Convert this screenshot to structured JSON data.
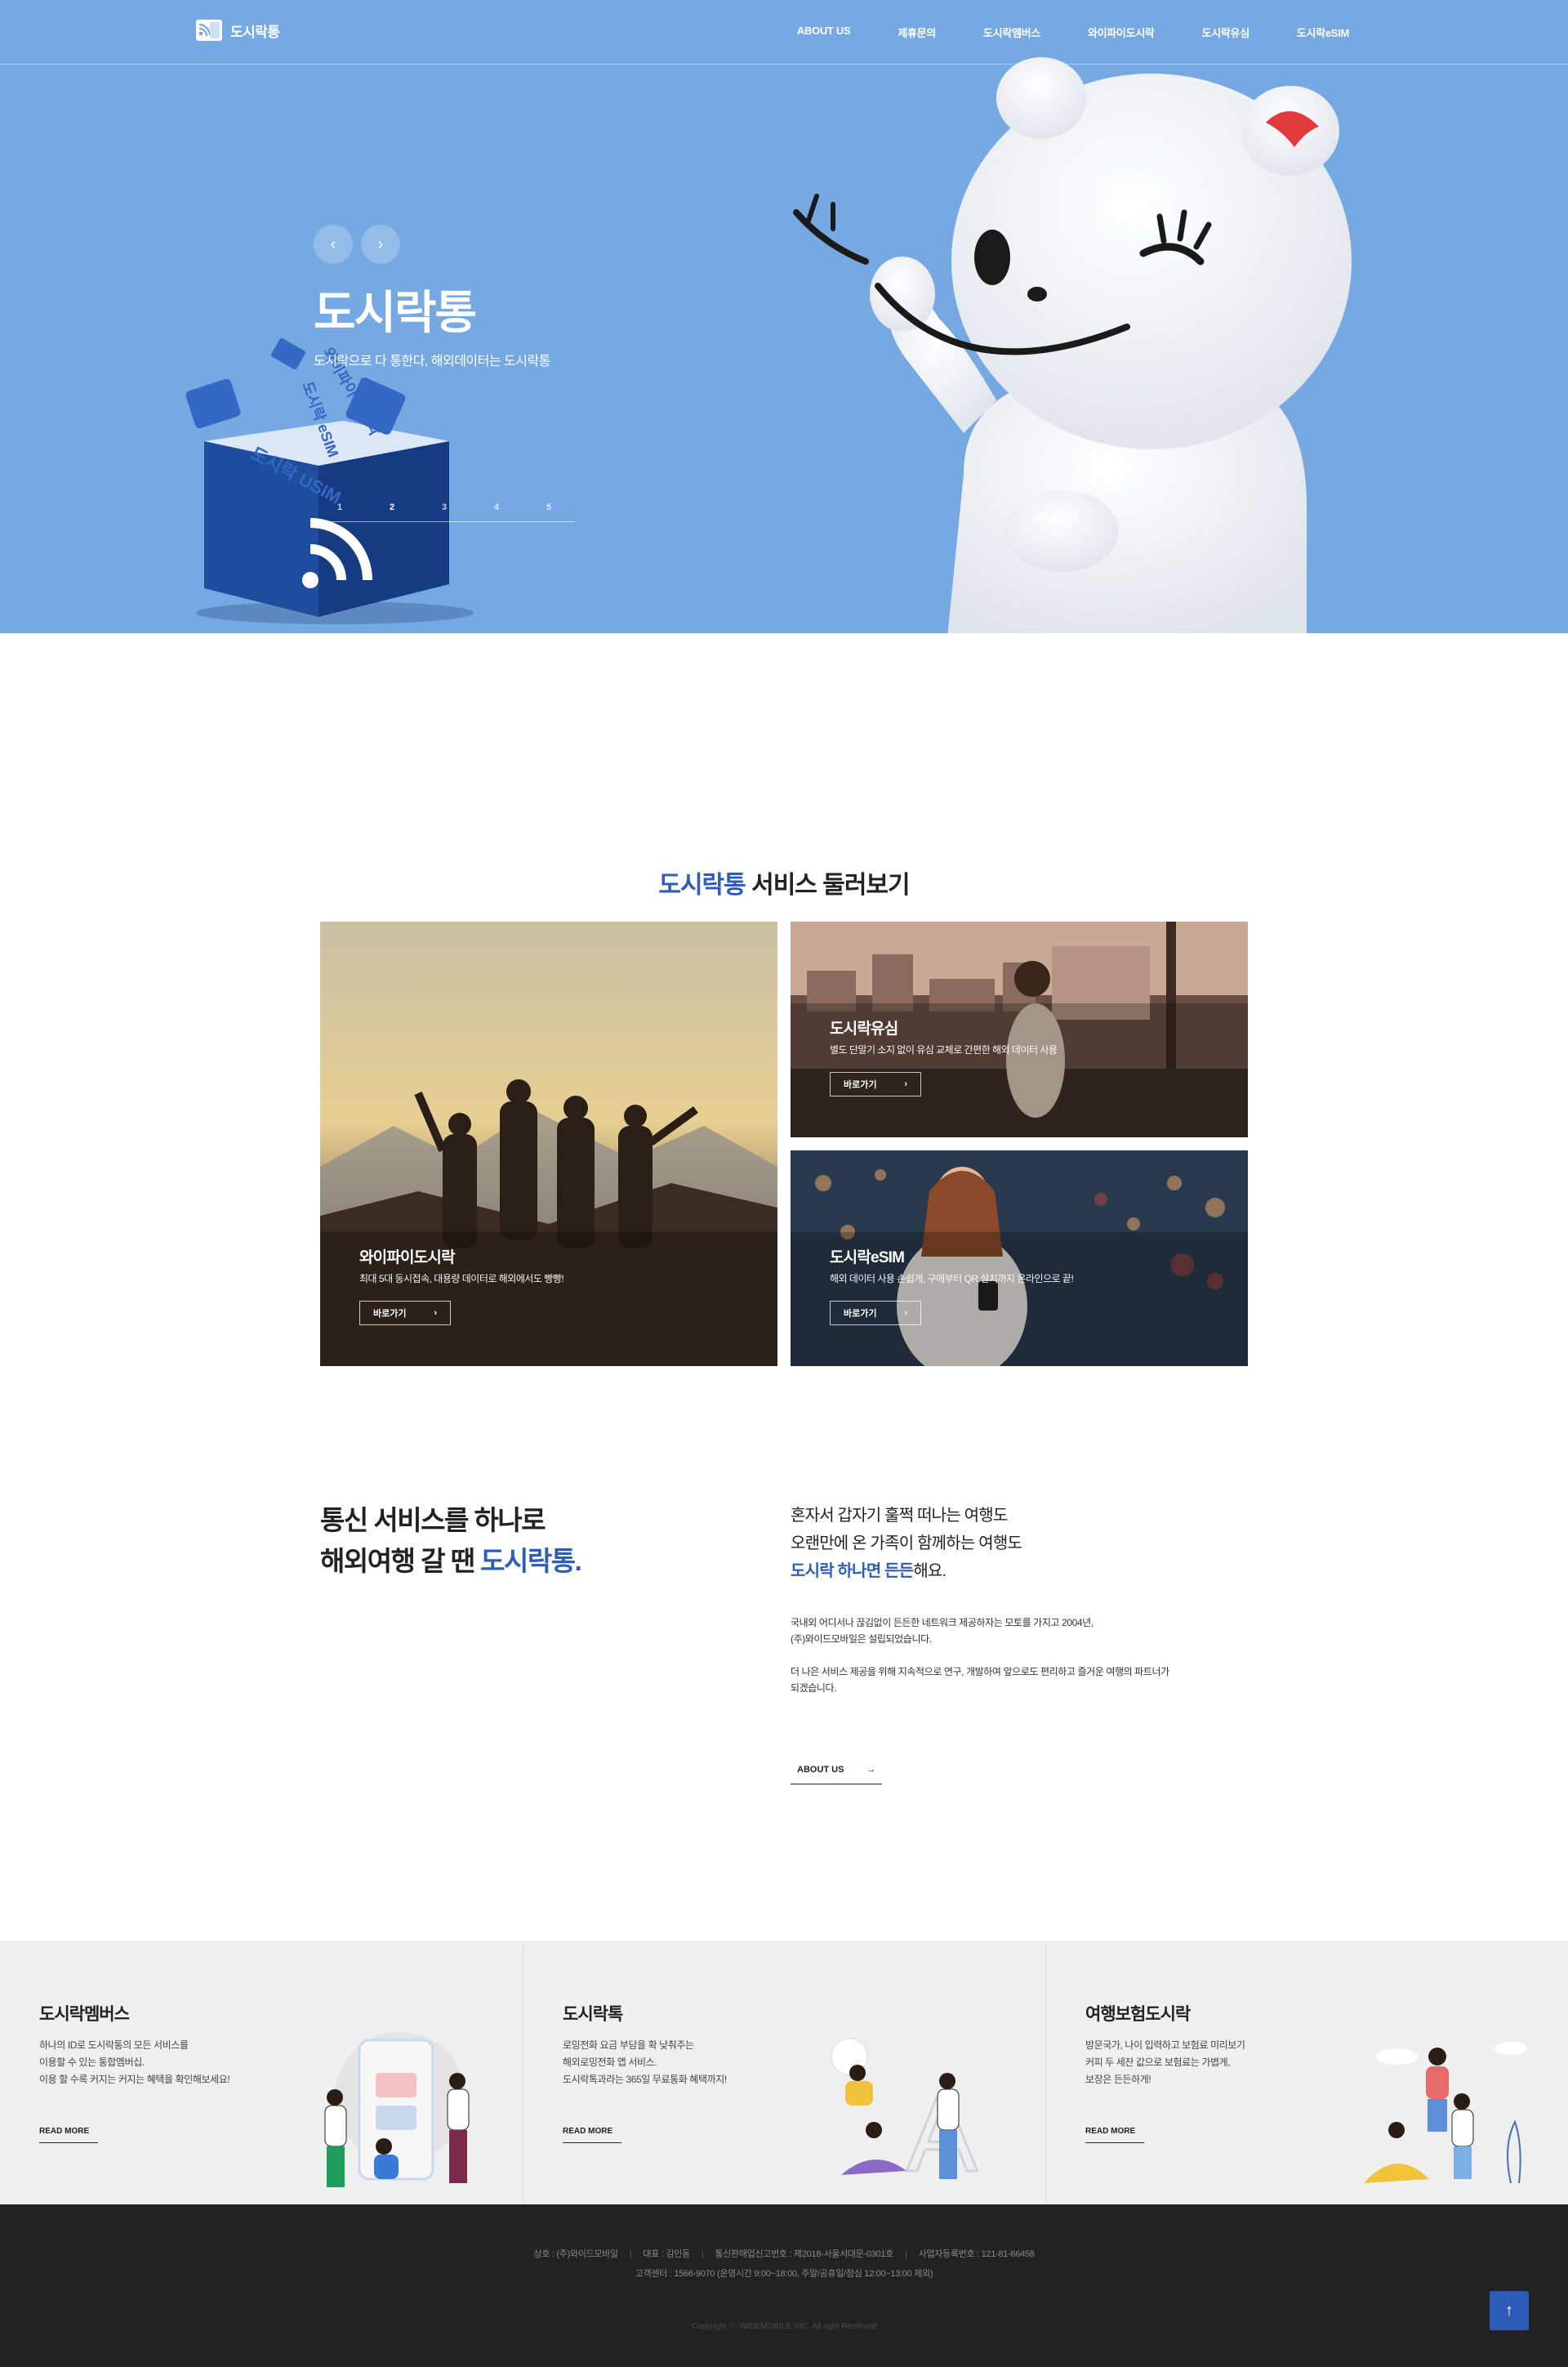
{
  "header": {
    "logo_text": "도시락통",
    "menu": [
      "ABOUT US",
      "제휴문의",
      "도시락멤버스",
      "와이파이도시락",
      "도시락유심",
      "도시락eSIM"
    ]
  },
  "hero": {
    "title": "도시락통",
    "subtitle": "도시락으로 다 통한다, 해외데이터는 도시락통",
    "pager": [
      "1",
      "2",
      "3",
      "4",
      "5"
    ],
    "active_page": "2",
    "prev_icon": "chevron-left-icon",
    "next_icon": "chevron-right-icon",
    "cube_labels": [
      "도시락 USIM",
      "도시락 eSIM",
      "와이파이 도시락"
    ]
  },
  "services": {
    "heading_accent": "도시락통",
    "heading_rest": " 서비스 둘러보기",
    "cards": [
      {
        "title": "와이파이도시락",
        "desc": "최대 5대 동시접속, 대용량 데이터로 해외에서도 빵빵!",
        "button": "바로가기"
      },
      {
        "title": "도시락유심",
        "desc": "별도 단말기 소지 없이 유심 교체로 간편한 해외 데이터 사용",
        "button": "바로가기"
      },
      {
        "title": "도시락eSIM",
        "desc": "해외 데이터 사용 손쉽게, 구매부터 QR 설치까지 온라인으로 끝!",
        "button": "바로가기"
      }
    ]
  },
  "about": {
    "headline_line1": "통신 서비스를 하나로",
    "headline_line2_pre": "해외여행 갈 땐 ",
    "headline_line2_accent": "도시락통.",
    "lead_line1": "혼자서 갑자기 훌쩍 떠나는 여행도",
    "lead_line2": "오랜만에 온 가족이 함께하는 여행도",
    "lead_line3_accent": "도시락 하나면 든든",
    "lead_line3_rest": "해요.",
    "body1_line1": "국내외 어디서나 끊김없이 든든한 네트워크 제공하자는 모토를 가지고 2004년,",
    "body1_line2": "(주)와이드모바일은 설립되었습니다.",
    "body2_line1": "더 나은 서비스 제공을 위해 지속적으로 연구, 개발하여 앞으로도 편리하고 즐거운 여행의 파트너가",
    "body2_line2": "되겠습니다.",
    "button": "ABOUT US",
    "button_icon": "arrow-right-icon"
  },
  "promo": [
    {
      "title": "도시락멤버스",
      "lines": [
        "하나의 ID로 도시락통의 모든 서비스를",
        "이용할 수 있는 통합멤버십.",
        "이용 할 수록 커지는 커지는 혜택을 확인해보세요!"
      ],
      "button": "READ MORE"
    },
    {
      "title": "도시락톡",
      "lines": [
        "로밍전화 요금 부담을 확 낮춰주는",
        "해외로밍전화 앱 서비스.",
        "도시락톡과라는 365일 무료통화 혜택까지!"
      ],
      "button": "READ MORE"
    },
    {
      "title": "여행보험도시락",
      "lines": [
        "방문국가, 나이 입력하고 보험료 미리보기",
        "커피 두 세잔 값으로 보험료는 가볍게,",
        "보장은 든든하게!"
      ],
      "button": "READ MORE"
    }
  ],
  "footer": {
    "company": "상호 : (주)와이드모바일",
    "ceo": "대표 : 김인동",
    "telecom_reg": "통신판매업신고번호 : 제2018-서울서대문-0301호",
    "biz_reg": "사업자등록번호 : 121-81-66458",
    "service_center": "고객센터 : 1566-9070 (운영시간 9:00~18:00, 주말/공휴일/점심 12:00~13:00 제외)",
    "copyright": "Copyright ⓒ WIDEMOBILE INC. All right Reserved",
    "top_button_icon": "arrow-up-icon"
  },
  "colors": {
    "hero_bg": "#76a9e2",
    "accent": "#2e5db6",
    "promo_bg": "#efefef",
    "footer_bg": "#222222"
  }
}
